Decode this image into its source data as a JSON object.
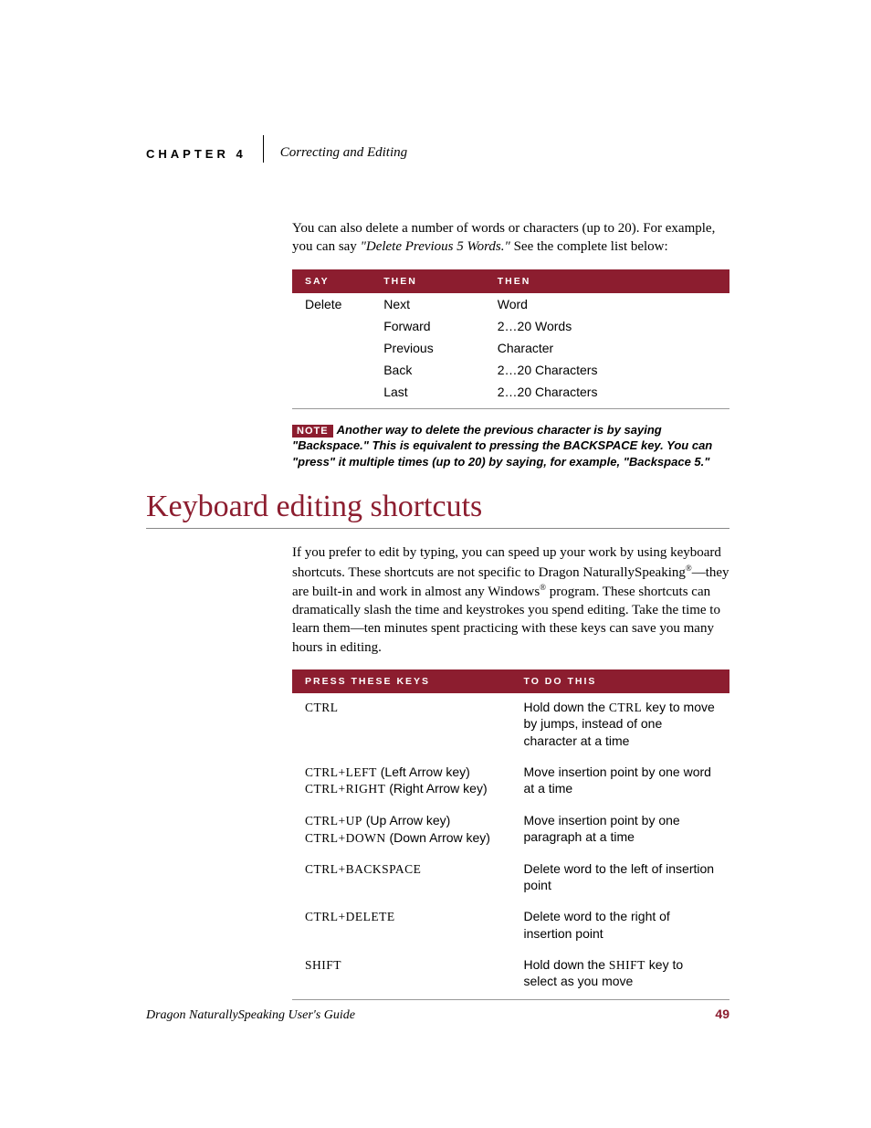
{
  "header": {
    "chapter_label": "CHAPTER 4",
    "chapter_title": "Correcting and Editing"
  },
  "intro": {
    "pre": "You can also delete a number of words or characters (up to 20). For example, you can say ",
    "ital": "\"Delete Previous 5 Words.\"",
    "post": " See the complete list below:"
  },
  "table1": {
    "headers": [
      "SAY",
      "THEN",
      "THEN"
    ],
    "rows": [
      [
        "Delete",
        "Next",
        "Word"
      ],
      [
        "",
        "Forward",
        "2…20 Words"
      ],
      [
        "",
        "Previous",
        "Character"
      ],
      [
        "",
        "Back",
        "2…20 Characters"
      ],
      [
        "",
        "Last",
        "2…20 Characters"
      ]
    ]
  },
  "note": {
    "badge": "NOTE",
    "text": "Another way to delete the previous character is by saying \"Backspace.\" This is equivalent to pressing the BACKSPACE key. You can \"press\" it multiple times (up to 20) by saying, for example, \"Backspace 5.\""
  },
  "section_heading": "Keyboard editing shortcuts",
  "section_para_pre": "If you prefer to edit by typing, you can speed up your work by using keyboard shortcuts. These shortcuts are not specific to Dragon NaturallySpeaking",
  "section_para_reg": "®",
  "section_para_mid": "—they are built-in and work in almost any Windows",
  "section_para_reg2": "®",
  "section_para_post": " program. These shortcuts can dramatically slash the time and keystrokes you spend editing. Take the time to learn them—ten minutes spent practicing with these keys can save you many hours in editing.",
  "table2": {
    "headers": [
      "PRESS THESE KEYS",
      "TO DO THIS"
    ],
    "rows": [
      {
        "keys_sc": "CTRL",
        "keys_plain": "",
        "do_pre": "Hold down the ",
        "do_sc": "CTRL",
        "do_post": " key to move by jumps, instead of one character at a time"
      },
      {
        "keys_sc": "CTRL+LEFT",
        "keys_plain": " (Left Arrow key)",
        "keys_sc2": "CTRL+RIGHT",
        "keys_plain2": " (Right Arrow key)",
        "do": "Move insertion point by one word at a time"
      },
      {
        "keys_sc": "CTRL+UP",
        "keys_plain": " (Up Arrow key)",
        "keys_sc2": "CTRL+DOWN",
        "keys_plain2": " (Down Arrow key)",
        "do": "Move insertion point by one paragraph at a time"
      },
      {
        "keys_sc": "CTRL+BACKSPACE",
        "keys_plain": "",
        "do": "Delete word to the left of insertion point"
      },
      {
        "keys_sc": "CTRL+DELETE",
        "keys_plain": "",
        "do": "Delete word to the right of insertion point"
      },
      {
        "keys_sc": "SHIFT",
        "keys_plain": "",
        "do_pre": "Hold down the ",
        "do_sc": "SHIFT",
        "do_post": " key to select as you move"
      }
    ]
  },
  "footer": {
    "title": "Dragon NaturallySpeaking User's Guide",
    "page": "49"
  }
}
